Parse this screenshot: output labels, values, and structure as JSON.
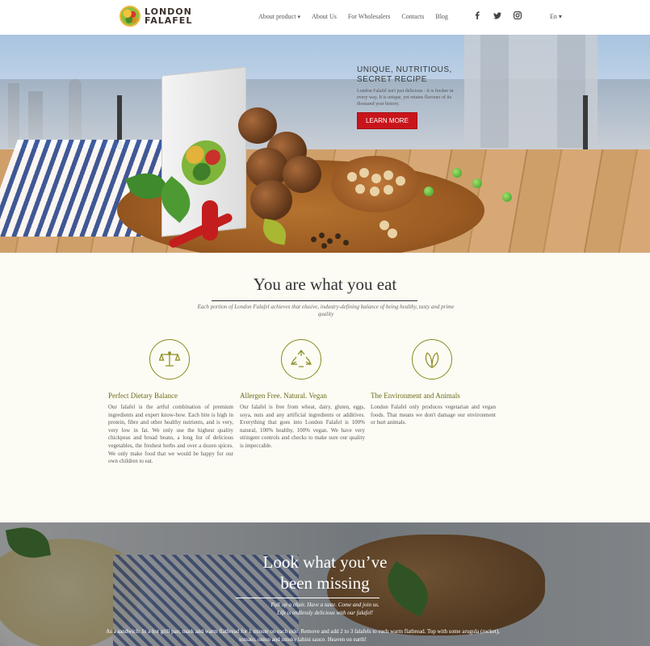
{
  "header": {
    "logo_line1": "LONDON",
    "logo_line2": "FALAFEL",
    "nav": [
      {
        "label": "About product",
        "has_dropdown": true
      },
      {
        "label": "About Us"
      },
      {
        "label": "For Wholesalers"
      },
      {
        "label": "Contacts"
      },
      {
        "label": "Blog"
      }
    ],
    "social": [
      "facebook-icon",
      "twitter-icon",
      "instagram-icon"
    ],
    "language": "En"
  },
  "hero": {
    "title": "UNIQUE, NUTRITIOUS, SECRET RECIPE",
    "description": "London Falafel isn't just delicious - it is fresher in every way. It is unique, yet retains flavours of its thousand year history.",
    "button": "LEARN MORE"
  },
  "intro": {
    "title": "You are what you eat",
    "subtitle": "Each portion of London Falafel achieves that elusive, industry-defining balance of being healthy, tasty and prime quality",
    "features": [
      {
        "icon": "scales-icon",
        "title": "Perfect Dietary Balance",
        "text": "Our falafel is the artful combination of premium ingredients and expert know-how. Each bite is high in protein, fibre and other healthy nutrients, and is very, very low in fat. We only use the highest quality chickpeas and broad beans, a long list of delicious vegetables, the freshest herbs and over a dozen spices. We only make food that we would be happy for our own children to eat."
      },
      {
        "icon": "recycle-icon",
        "title": "Allergen Free. Natural. Vegan",
        "text": "Our falafel is free from wheat, dairy, gluten, eggs, soya, nuts and any artificial ingredients or additives. Everything that goes into London Falafel is 100% natural, 100% healthy, 100% vegan. We have very stringent controls and checks to make sure our quality is impeccable."
      },
      {
        "icon": "leaf-icon",
        "title": "The Environment and Animals",
        "text": "London Falafel only produces vegetarian and vegan foods. That means we don't damage our environment or hurt animals."
      }
    ]
  },
  "banner": {
    "title_line1": "Look what you’ve",
    "title_line2": "been missing",
    "subtitle_line1": "Pull up a chair. Have a taste. Come and join us.",
    "subtitle_line2": "Life is endlessly delicious with our falafel!",
    "text": "As a sandwich: In a hot grill pan, mark and warm flatbread for 1 minute on each side. Remove and add 2 to 3 falafels to each warm flatbread. Top with some arugula (rocket), tomato, onion and smoky tahini sauce. Heaven on earth!"
  }
}
